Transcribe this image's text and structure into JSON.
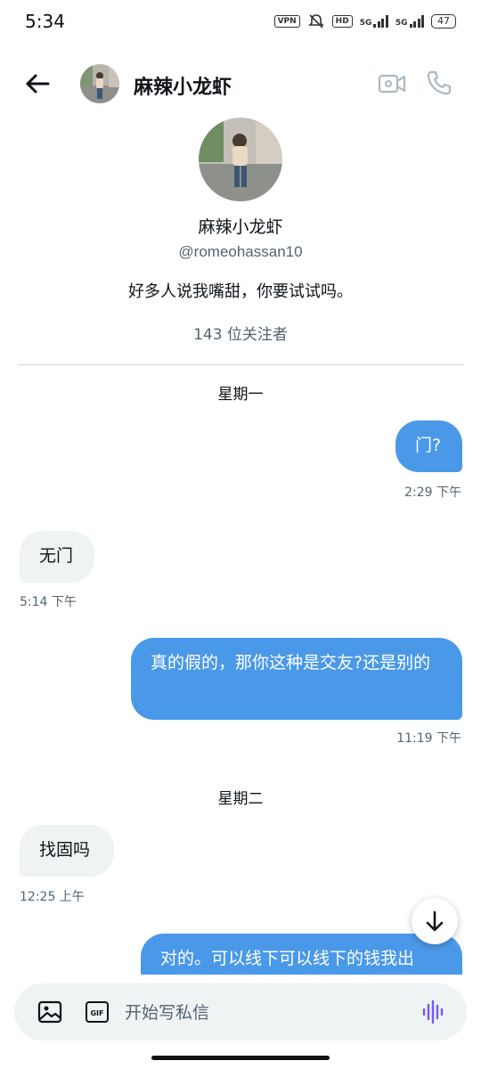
{
  "status_bar": {
    "time": "5:34",
    "vpn": "VPN",
    "hd": "HD",
    "net1": "5G",
    "net2": "5G",
    "battery": "47"
  },
  "header": {
    "title": "麻辣小龙虾"
  },
  "profile": {
    "name": "麻辣小龙虾",
    "handle": "@romeohassan10",
    "bio": "好多人说我嘴甜，你要试试吗。",
    "followers": "143 位关注者"
  },
  "messages": {
    "day1": "星期一",
    "m1": {
      "text": "门?",
      "time": "2:29 下午"
    },
    "m2": {
      "text": "无门",
      "time": "5:14 下午"
    },
    "m3": {
      "text": "真的假的，那你这种是交友?还是别的",
      "time": "11:19 下午"
    },
    "day2": "星期二",
    "m4": {
      "text": "找固吗",
      "time": "12:25 上午"
    },
    "m5": {
      "text": "对的。可以线下可以线下的钱我出"
    }
  },
  "composer": {
    "placeholder": "开始写私信"
  },
  "colors": {
    "sent_bubble": "#4a99e9",
    "received_bubble": "#eff3f4",
    "voice_accent": "#7856ff"
  },
  "icons": [
    "back-arrow-icon",
    "video-call-icon",
    "phone-icon",
    "scroll-down-icon",
    "image-icon",
    "gif-icon",
    "voice-icon"
  ]
}
